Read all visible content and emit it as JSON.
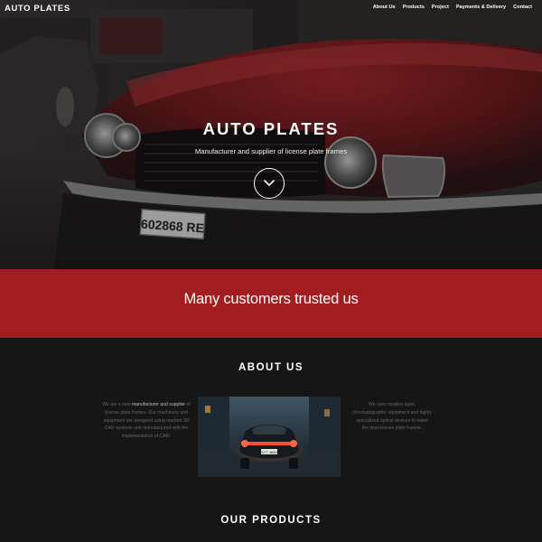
{
  "nav": {
    "brand": "AUTO PLATES",
    "items": [
      {
        "label": "About Us"
      },
      {
        "label": "Products"
      },
      {
        "label": "Project"
      },
      {
        "label": "Payments & Delivery"
      },
      {
        "label": "Contact"
      }
    ]
  },
  "hero": {
    "title": "AUTO PLATES",
    "subtitle": "Manufacturer and supplier of license plate frames",
    "scroll_icon": "chevron-down-icon",
    "plate_text": "602868 RE"
  },
  "band": {
    "text": "Many customers trusted us",
    "color": "#a11d1f"
  },
  "about": {
    "title": "ABOUT US",
    "left": {
      "pre": "We are a new ",
      "highlight1": "manufacturer and supplier",
      "mid": " of license plate frames. Our machinery and equipment are designed using modern 3D CAD systems and manufactured with the implementation of CAM."
    },
    "right": "We uses modern laser, chromatographic equipment and highly specialized optical devices to make the best license plate frames.",
    "image_plate": "SYT 4680"
  },
  "products": {
    "title": "OUR PRODUCTS"
  }
}
